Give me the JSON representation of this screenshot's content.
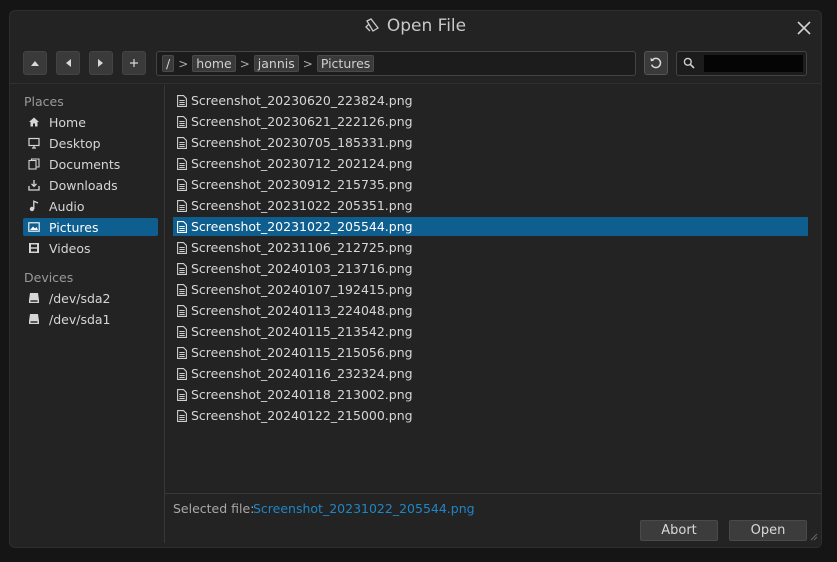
{
  "window": {
    "title": "Open File"
  },
  "toolbar": {
    "buttons": [
      {
        "name": "up-button",
        "icon": "triangle-up-icon"
      },
      {
        "name": "back-button",
        "icon": "triangle-left-icon"
      },
      {
        "name": "forward-button",
        "icon": "triangle-right-icon"
      },
      {
        "name": "new-folder-button",
        "icon": "plus-icon"
      }
    ],
    "path": [
      "/",
      "home",
      "jannis",
      "Pictures"
    ],
    "path_separator": ">",
    "refresh_icon": "refresh-icon",
    "search_icon": "search-icon",
    "search_value": ""
  },
  "sidebar": {
    "places_title": "Places",
    "places": [
      {
        "label": "Home",
        "icon": "home-icon"
      },
      {
        "label": "Desktop",
        "icon": "monitor-icon"
      },
      {
        "label": "Documents",
        "icon": "documents-icon"
      },
      {
        "label": "Downloads",
        "icon": "download-icon"
      },
      {
        "label": "Audio",
        "icon": "music-note-icon"
      },
      {
        "label": "Pictures",
        "icon": "image-icon",
        "selected": true
      },
      {
        "label": "Videos",
        "icon": "film-icon"
      }
    ],
    "devices_title": "Devices",
    "devices": [
      {
        "label": "/dev/sda2",
        "icon": "drive-icon"
      },
      {
        "label": "/dev/sda1",
        "icon": "drive-icon"
      }
    ]
  },
  "files": [
    {
      "name": "Screenshot_20230620_223824.png"
    },
    {
      "name": "Screenshot_20230621_222126.png"
    },
    {
      "name": "Screenshot_20230705_185331.png"
    },
    {
      "name": "Screenshot_20230712_202124.png"
    },
    {
      "name": "Screenshot_20230912_215735.png"
    },
    {
      "name": "Screenshot_20231022_205351.png"
    },
    {
      "name": "Screenshot_20231022_205544.png",
      "selected": true
    },
    {
      "name": "Screenshot_20231106_212725.png"
    },
    {
      "name": "Screenshot_20240103_213716.png"
    },
    {
      "name": "Screenshot_20240107_192415.png"
    },
    {
      "name": "Screenshot_20240113_224048.png"
    },
    {
      "name": "Screenshot_20240115_213542.png"
    },
    {
      "name": "Screenshot_20240115_215056.png"
    },
    {
      "name": "Screenshot_20240116_232324.png"
    },
    {
      "name": "Screenshot_20240118_213002.png"
    },
    {
      "name": "Screenshot_20240122_215000.png"
    }
  ],
  "footer": {
    "selected_label": "Selected file:",
    "selected_value": "Screenshot_20231022_205544.png",
    "abort_label": "Abort",
    "open_label": "Open"
  },
  "colors": {
    "accent": "#0e5f8f",
    "link": "#1f86c6",
    "background": "#232323"
  }
}
